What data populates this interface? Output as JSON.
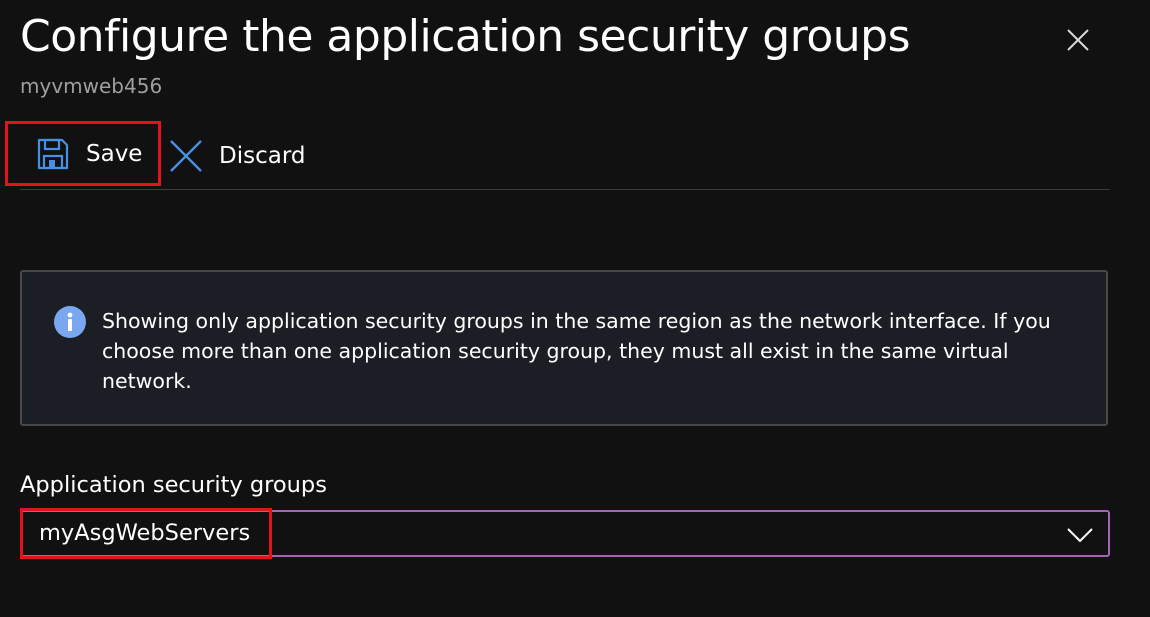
{
  "panel": {
    "title": "Configure the application security groups",
    "subtitle": "myvmweb456"
  },
  "toolbar": {
    "save_label": "Save",
    "discard_label": "Discard"
  },
  "info": {
    "message": "Showing only application security groups in the same region as the network interface. If you choose more than one application security group, they must all exist in the same virtual network."
  },
  "form": {
    "asg_label": "Application security groups",
    "asg_selected": "myAsgWebServers"
  },
  "icons": {
    "close": "close-icon",
    "save": "save-icon",
    "discard": "discard-icon",
    "info": "info-icon",
    "dropdown": "chevron-down-icon"
  },
  "colors": {
    "background": "#111111",
    "accent_blue": "#4a90e2",
    "info_box_bg": "#1b1e24",
    "focus_border": "#a762b8",
    "highlight_red": "#e0141e",
    "subtitle_gray": "#9e9e9e"
  }
}
